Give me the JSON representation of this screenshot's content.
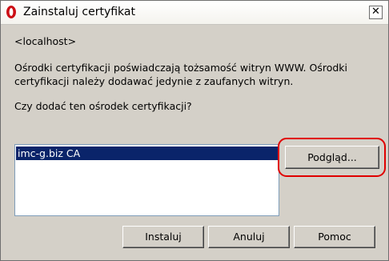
{
  "window": {
    "title": "Zainstaluj certyfikat",
    "icon": "opera-icon",
    "close_label": "✕"
  },
  "dialog": {
    "host": "<localhost>",
    "info_line1": "Ośrodki certyfikacji poświadczają tożsamość witryn WWW. Ośrodki",
    "info_line2": "certyfikacji należy dodawać jedynie z zaufanych witryn.",
    "question": "Czy dodać ten ośrodek certyfikacji?"
  },
  "certificate_list": {
    "items": [
      {
        "label": "imc-g.biz CA",
        "selected": true
      }
    ]
  },
  "buttons": {
    "view": "Podgląd...",
    "install": "Instaluj",
    "cancel": "Anuluj",
    "help": "Pomoc"
  },
  "colors": {
    "highlight_border": "#e00000",
    "selection": "#0a246a",
    "opera_red": "#cc0f16"
  }
}
